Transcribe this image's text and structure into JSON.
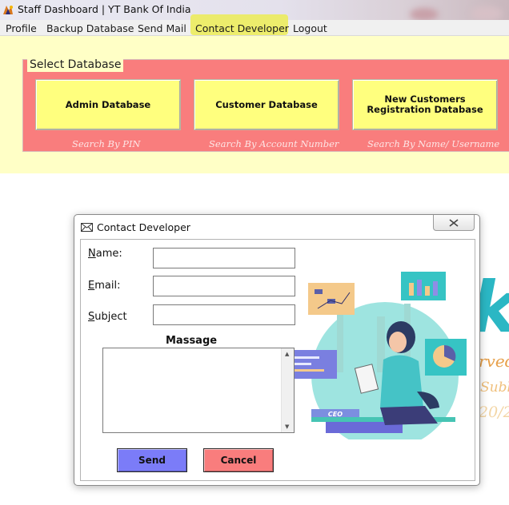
{
  "window": {
    "title": "Staff Dashboard | YT Bank Of India"
  },
  "menu": {
    "items": [
      "Profile",
      "Backup Database",
      "Send Mail",
      "Contact Developer",
      "Logout"
    ],
    "highlighted": "Contact Developer",
    "highlight_color": "#ecec55"
  },
  "select_database": {
    "group_title": "Select Database",
    "buttons": [
      {
        "label": "Admin Database",
        "caption": "Search By PIN"
      },
      {
        "label": "Customer Database",
        "caption": "Search By Account Number"
      },
      {
        "label": "New Customers Registration Database",
        "caption": "Search By Name/ Username"
      }
    ],
    "panel_color": "#ffffc6",
    "group_color": "#f97d7d",
    "button_color": "#ffff7e"
  },
  "background": {
    "fragments": [
      "k",
      "rved",
      "Subl",
      "20/2"
    ]
  },
  "dialog": {
    "title": "Contact Developer",
    "close_icon": "close-icon",
    "title_icon": "envelope-icon",
    "fields": {
      "name_label_accel": "N",
      "name_label_rest": "ame:",
      "email_label_accel": "E",
      "email_label_rest": "mail:",
      "subject_label_accel": "S",
      "subject_label_rest": "ubject",
      "name_value": "",
      "email_value": "",
      "subject_value": ""
    },
    "message_label": "Massage",
    "message_value": "",
    "send_label": "Send",
    "cancel_label": "Cancel",
    "send_color": "#7b7cf8",
    "cancel_color": "#f97d7d",
    "illustration": {
      "badge": "CEO"
    }
  }
}
